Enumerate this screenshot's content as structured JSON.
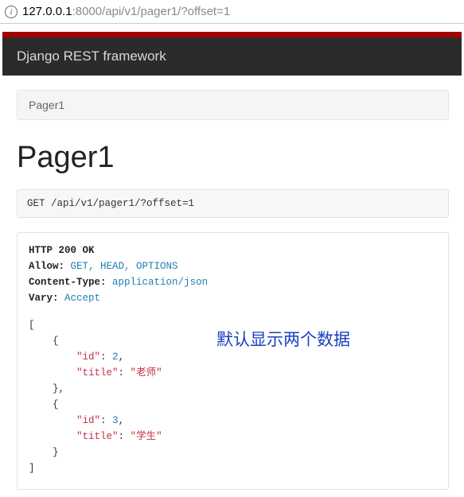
{
  "address_bar": {
    "host": "127.0.0.1",
    "rest": ":8000/api/v1/pager1/?offset=1"
  },
  "navbar": {
    "brand": "Django REST framework"
  },
  "breadcrumb": {
    "current": "Pager1"
  },
  "page": {
    "title": "Pager1"
  },
  "request": {
    "method": "GET",
    "path": "/api/v1/pager1/?offset=1"
  },
  "response": {
    "status_line": "HTTP 200 OK",
    "headers": {
      "allow_label": "Allow:",
      "allow_value": "GET, HEAD, OPTIONS",
      "ctype_label": "Content-Type:",
      "ctype_value": "application/json",
      "vary_label": "Vary:",
      "vary_value": "Accept"
    },
    "body": [
      {
        "id": 2,
        "title": "老师"
      },
      {
        "id": 3,
        "title": "学生"
      }
    ],
    "keys": {
      "id": "\"id\"",
      "title": "\"title\""
    }
  },
  "annotation": "默认显示两个数据"
}
